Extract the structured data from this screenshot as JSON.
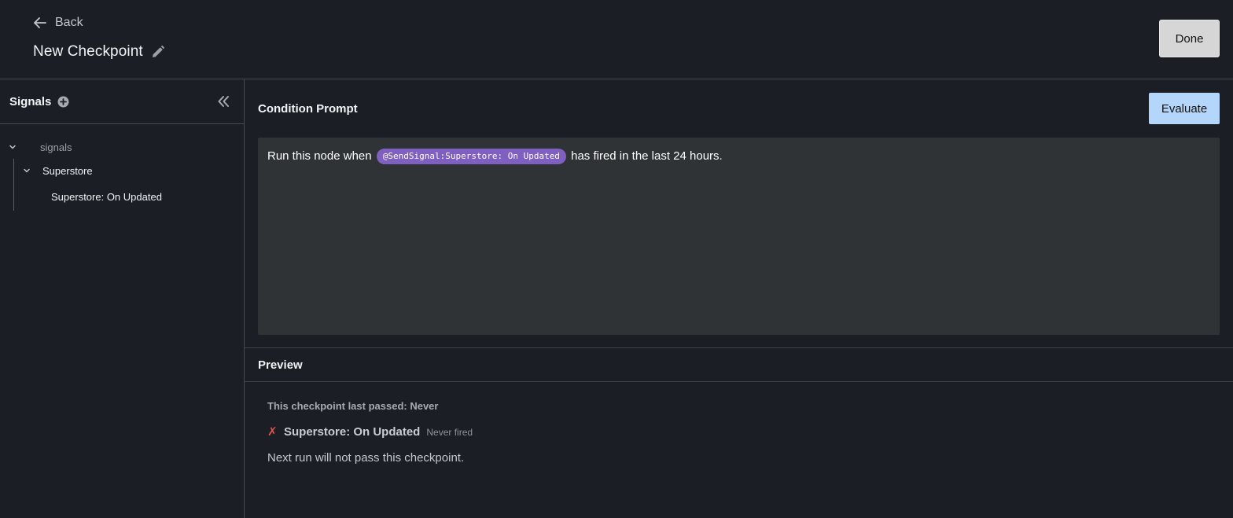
{
  "header": {
    "back_label": "Back",
    "title": "New Checkpoint",
    "done_label": "Done"
  },
  "sidebar": {
    "title": "Signals",
    "tree": {
      "root_label": "signals",
      "group_label": "Superstore",
      "item_label": "Superstore: On Updated"
    }
  },
  "condition": {
    "title": "Condition Prompt",
    "evaluate_label": "Evaluate",
    "prompt_before": "Run this node when",
    "chip_label": "@SendSignal:Superstore: On Updated",
    "prompt_after": "has fired in the last 24 hours."
  },
  "preview": {
    "title": "Preview",
    "last_passed": "This checkpoint last passed: Never",
    "status_icon": "✗",
    "signal_name": "Superstore: On Updated",
    "signal_status": "Never fired",
    "next_run": "Next run will not pass this checkpoint."
  },
  "colors": {
    "background": "#1b1f25",
    "border": "#464b52",
    "prompt_bg": "#2f3336",
    "chip": "#7f5fc0",
    "evaluate_button": "#b4d6fb",
    "done_button": "#d6d6d6",
    "fail": "#e0524f"
  },
  "icons": {
    "back": "arrow-left-icon",
    "edit": "pencil-icon",
    "add": "plus-circle-icon",
    "collapse": "double-chevron-left-icon",
    "expand": "chevron-down-icon",
    "fail": "cross-mark-icon"
  }
}
